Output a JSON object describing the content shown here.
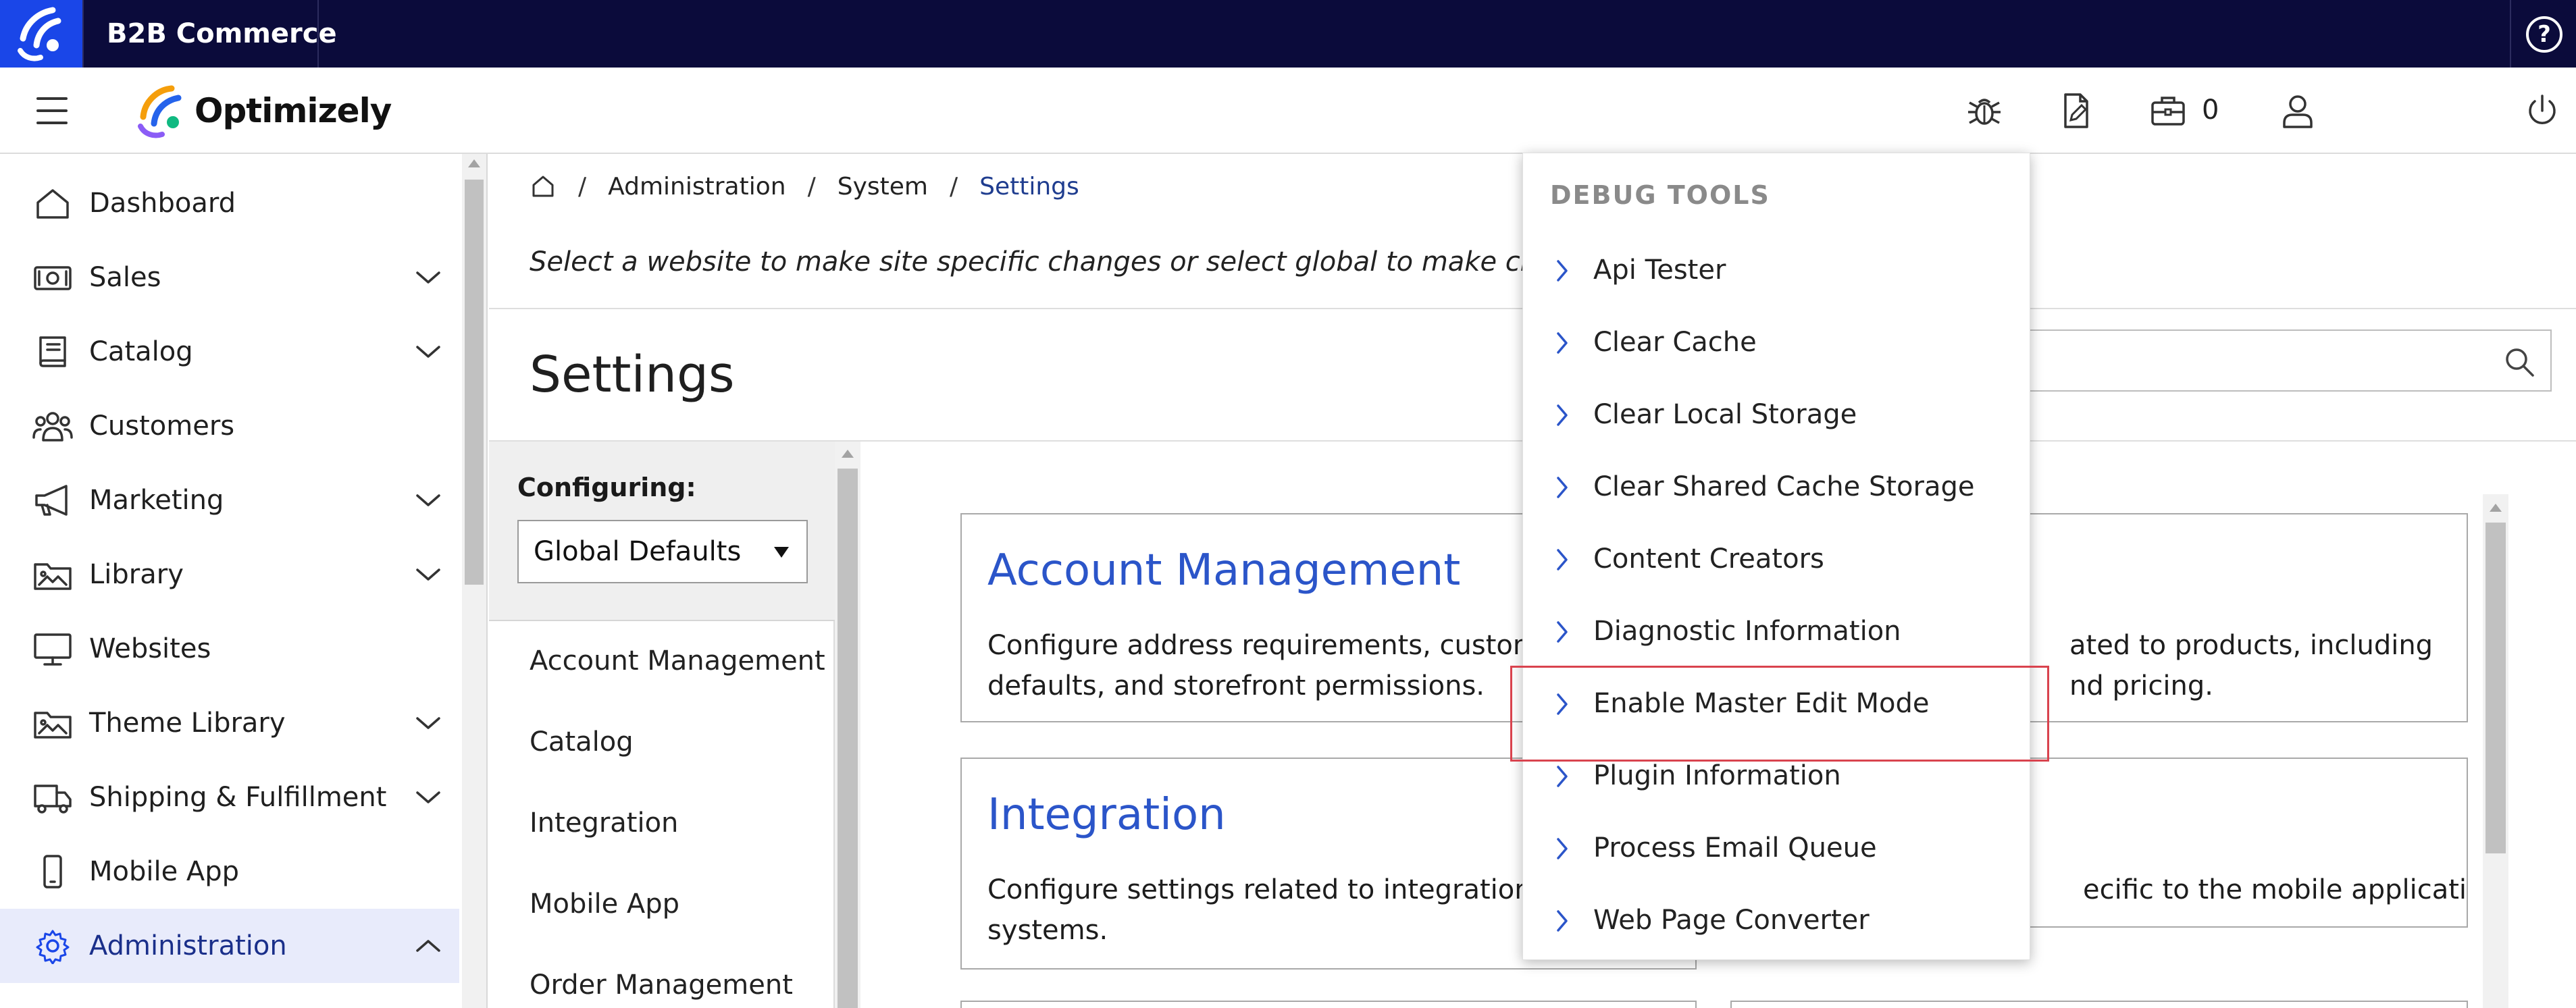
{
  "topbar": {
    "title": "B2B Commerce",
    "help_label": "?"
  },
  "header": {
    "logo_text": "Optimizely",
    "cart_count": "0"
  },
  "sidebar": {
    "items": [
      {
        "label": "Dashboard",
        "icon": "home-icon",
        "expandable": false
      },
      {
        "label": "Sales",
        "icon": "money-icon",
        "expandable": true
      },
      {
        "label": "Catalog",
        "icon": "book-icon",
        "expandable": true
      },
      {
        "label": "Customers",
        "icon": "users-icon",
        "expandable": false
      },
      {
        "label": "Marketing",
        "icon": "megaphone-icon",
        "expandable": true
      },
      {
        "label": "Library",
        "icon": "image-folder-icon",
        "expandable": true
      },
      {
        "label": "Websites",
        "icon": "monitor-icon",
        "expandable": false
      },
      {
        "label": "Theme Library",
        "icon": "image-folder-icon",
        "expandable": true
      },
      {
        "label": "Shipping & Fulfillment",
        "icon": "truck-icon",
        "expandable": true
      },
      {
        "label": "Mobile App",
        "icon": "phone-icon",
        "expandable": false
      },
      {
        "label": "Administration",
        "icon": "gear-icon",
        "expandable": true,
        "active": true
      }
    ]
  },
  "breadcrumb": {
    "items": [
      "Administration",
      "System"
    ],
    "current": "Settings"
  },
  "main": {
    "subtitle": "Select a website to make site specific changes or select global to make changes",
    "title": "Settings"
  },
  "config": {
    "label": "Configuring:",
    "selected": "Global Defaults",
    "items": [
      "Account Management",
      "Catalog",
      "Integration",
      "Mobile App",
      "Order Management"
    ]
  },
  "cards": [
    {
      "title": "Account Management",
      "desc1": "Configure address requirements, customer",
      "desc2": "defaults, and storefront permissions."
    },
    {
      "title": "",
      "desc1": "ated to products, including",
      "desc2": "nd pricing."
    },
    {
      "title": "Integration",
      "desc1": "Configure settings related to integration wit",
      "desc2": "systems."
    },
    {
      "title": "",
      "desc1": "ecific to the mobile application.",
      "desc2": ""
    }
  ],
  "debug_menu": {
    "title": "DEBUG TOOLS",
    "items": [
      "Api Tester",
      "Clear Cache",
      "Clear Local Storage",
      "Clear Shared Cache Storage",
      "Content Creators",
      "Diagnostic Information",
      "Enable Master Edit Mode",
      "Plugin Information",
      "Process Email Queue",
      "Web Page Converter"
    ],
    "highlighted": "Enable Master Edit Mode"
  },
  "colors": {
    "topbar": "#0b0b3b",
    "brand_blue": "#1a46e8",
    "link_blue": "#2b55c9",
    "active_bg": "#e8ebfb",
    "highlight_red": "#d9434e"
  }
}
